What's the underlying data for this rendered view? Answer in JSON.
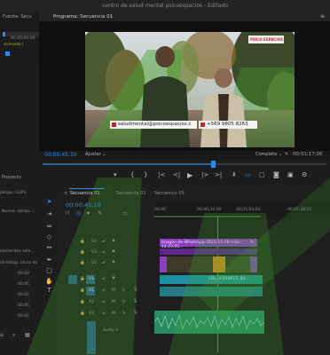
{
  "app": {
    "title": "centro de salud mental psicoespacios",
    "title_suffix": "- Editado"
  },
  "left_panel": {
    "header": "Fuente: Secu",
    "timecode": "00;00;00;00",
    "clip_label": "animada (",
    "bottom_tab": "Proyecto",
    "search_prefix": "jabajo: CLIPS",
    "sequence_label": "Nuevo: utiliza...",
    "elements_label": "elementos sele...",
    "photo_label": "de fotogr. Inicio de",
    "durations": [
      "00:00",
      "00:0C",
      "00:0C",
      "00:0C",
      "00:0C"
    ]
  },
  "program": {
    "title": "Programa: Secuencia 01",
    "timecode": "00;00;45;10",
    "fit": "Ajustar",
    "quality": "Completa",
    "duration": "00;01;17;06",
    "overlay_logo": "PSICO ESPACIOS",
    "overlay_email": "saludmental@psicoespacios.c",
    "overlay_phone": "+569 9805 8263",
    "controls": [
      "{",
      "}",
      "|<",
      "<|",
      "▶",
      "|>",
      ">|"
    ]
  },
  "timeline": {
    "tabs": [
      "Secuencia 01",
      "Secuencia 01",
      "Secuencia 03"
    ],
    "timecode": "00;00;45;10",
    "ruler": [
      "00;00",
      "00;00;32;00",
      "00;01;04;02",
      "00;01;36;02"
    ],
    "video_tracks": [
      "V4",
      "V3",
      "V2",
      "V1"
    ],
    "audio_tracks": [
      "A1",
      "A2",
      "A3"
    ],
    "audio3_label": "Audio 3",
    "clip_top": "Imagen-de-WhatsApp-2023-11-29-a-las-14.23.05...",
    "clip_v1": "CDI_20240612_1...",
    "fx": "fx",
    "colors": {
      "accent": "#2d8ceb",
      "purple": "#8a3fc0",
      "teal": "#1d8fa2",
      "audio_green": "#2a8a61"
    }
  }
}
